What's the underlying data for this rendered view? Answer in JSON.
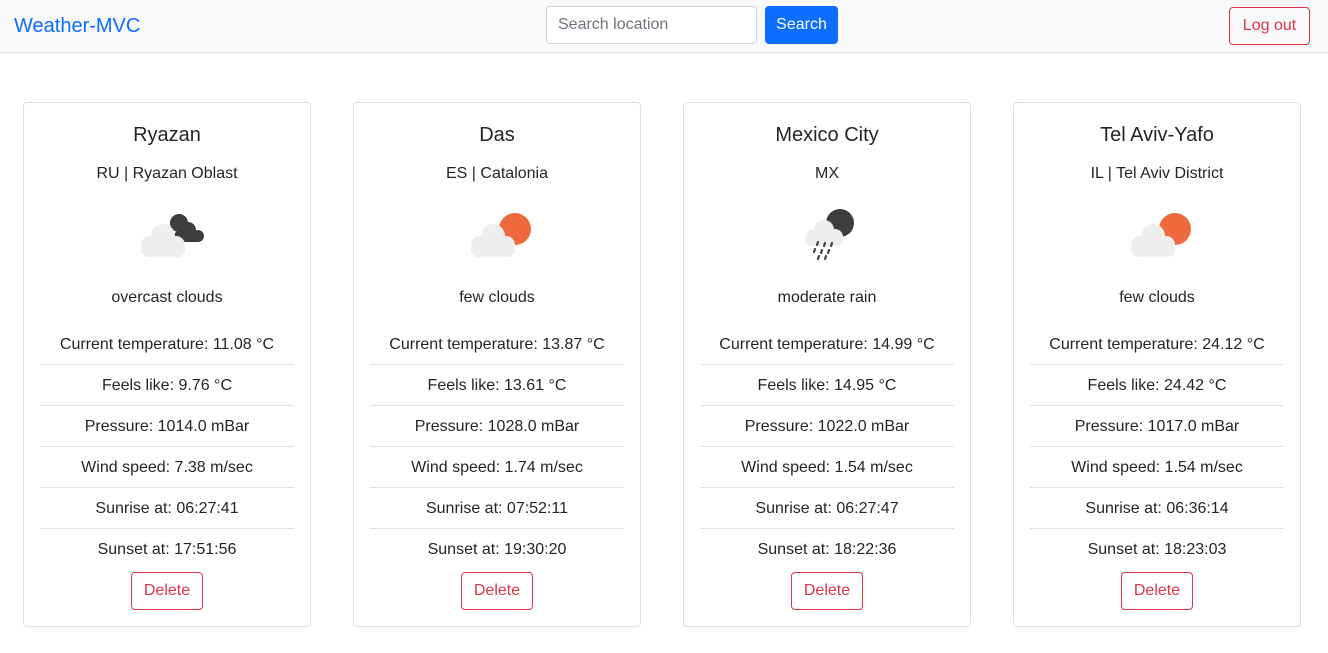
{
  "navbar": {
    "brand": "Weather-MVC",
    "search": {
      "placeholder": "Search location",
      "value": ""
    },
    "search_label": "Search",
    "logout_label": "Log out"
  },
  "colors": {
    "primary": "#0d6efd",
    "danger": "#dc3545",
    "navbar_bg": "#f8f9fa",
    "sun": "#ef6b3f",
    "dark_cloud": "#3d3d3d",
    "light_cloud": "#eeeeee"
  },
  "cards": [
    {
      "city": "Ryazan",
      "country": "RU | Ryazan Oblast",
      "icon": "overcast-clouds-icon",
      "description": "overcast clouds",
      "temperature": "Current temperature: 11.08 °C",
      "feels_like": "Feels like: 9.76 °C",
      "pressure": "Pressure: 1014.0 mBar",
      "wind": "Wind speed: 7.38 m/sec",
      "sunrise": "Sunrise at: 06:27:41",
      "sunset": "Sunset at: 17:51:56",
      "delete_label": "Delete"
    },
    {
      "city": "Das",
      "country": "ES | Catalonia",
      "icon": "few-clouds-day-icon",
      "description": "few clouds",
      "temperature": "Current temperature: 13.87 °C",
      "feels_like": "Feels like: 13.61 °C",
      "pressure": "Pressure: 1028.0 mBar",
      "wind": "Wind speed: 1.74 m/sec",
      "sunrise": "Sunrise at: 07:52:11",
      "sunset": "Sunset at: 19:30:20",
      "delete_label": "Delete"
    },
    {
      "city": "Mexico City",
      "country": "MX",
      "icon": "rain-night-icon",
      "description": "moderate rain",
      "temperature": "Current temperature: 14.99 °C",
      "feels_like": "Feels like: 14.95 °C",
      "pressure": "Pressure: 1022.0 mBar",
      "wind": "Wind speed: 1.54 m/sec",
      "sunrise": "Sunrise at: 06:27:47",
      "sunset": "Sunset at: 18:22:36",
      "delete_label": "Delete"
    },
    {
      "city": "Tel Aviv-Yafo",
      "country": "IL | Tel Aviv District",
      "icon": "few-clouds-day-icon",
      "description": "few clouds",
      "temperature": "Current temperature: 24.12 °C",
      "feels_like": "Feels like: 24.42 °C",
      "pressure": "Pressure: 1017.0 mBar",
      "wind": "Wind speed: 1.54 m/sec",
      "sunrise": "Sunrise at: 06:36:14",
      "sunset": "Sunset at: 18:23:03",
      "delete_label": "Delete"
    }
  ]
}
